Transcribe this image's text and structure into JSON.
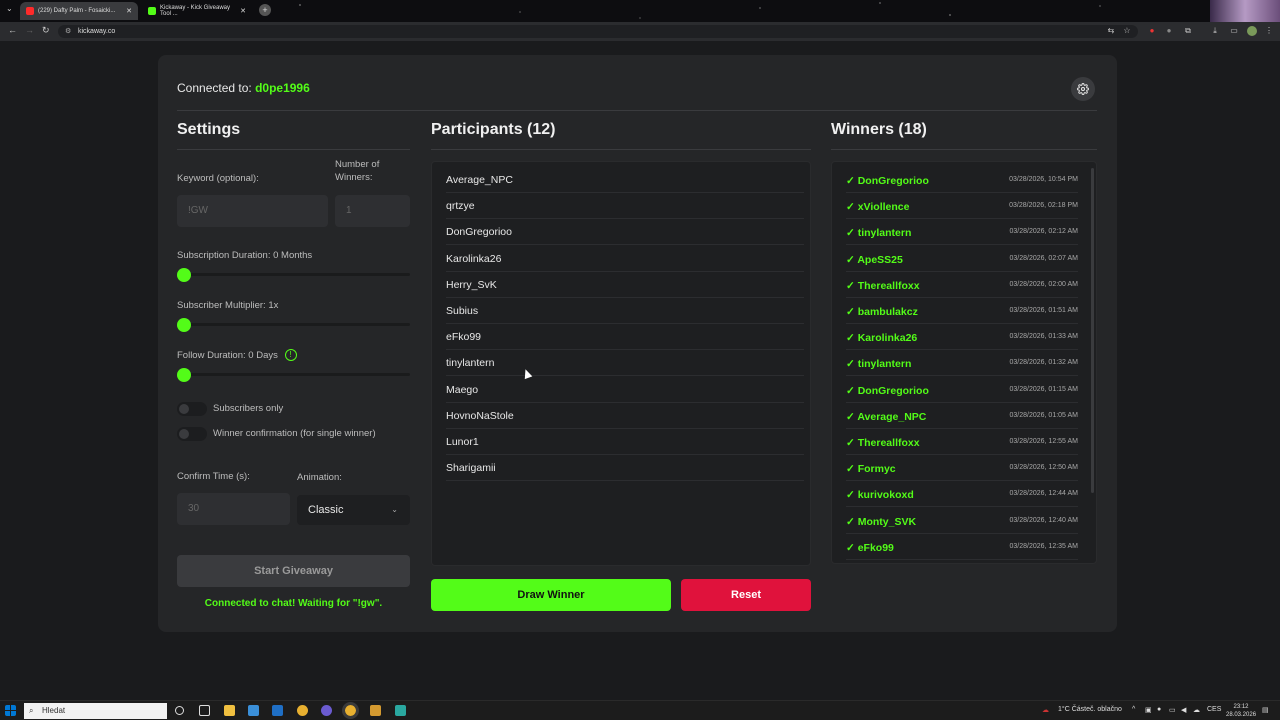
{
  "browser": {
    "tabs": [
      {
        "title": "(229) Dafty Palm - Fosaicki...",
        "active": true
      },
      {
        "title": "Kickaway - Kick Giveaway Tool ...",
        "active": false
      }
    ],
    "url": "kickaway.co"
  },
  "header": {
    "connected_prefix": "Connected to:",
    "username": "d0pe1996"
  },
  "settings": {
    "title": "Settings",
    "keyword_label": "Keyword (optional):",
    "keyword_placeholder": "!GW",
    "winners_label": "Number of Winners:",
    "winners_placeholder": "1",
    "sub_duration_label": "Subscription Duration: 0 Months",
    "sub_multiplier_label": "Subscriber Multiplier: 1x",
    "follow_label": "Follow Duration:",
    "follow_value": "0  Days",
    "follow_info": "!",
    "sliders": {
      "sub_duration": 0,
      "sub_multiplier": 0,
      "follow_duration": 0
    },
    "subscribers_only": "Subscribers only",
    "winner_confirmation": "Winner confirmation (for single winner)",
    "confirm_label": "Confirm Time (s):",
    "confirm_placeholder": "30",
    "animation_label": "Animation:",
    "animation_value": "Classic",
    "start_button": "Start Giveaway",
    "chat_status": "Connected to chat! Waiting for \"!gw\"."
  },
  "participants": {
    "title": "Participants (12)",
    "items": [
      "Average_NPC",
      "qrtzye",
      "DonGregorioo",
      "Karolinka26",
      "Herry_SvK",
      "Subius",
      "eFko99",
      "tinylantern",
      "Maego",
      "HovnoNaStole",
      "Lunor1",
      "Sharigamii"
    ]
  },
  "winners": {
    "title": "Winners (18)",
    "check": "✓",
    "items": [
      {
        "name": "DonGregorioo",
        "time": "03/28/2026, 10:54 PM"
      },
      {
        "name": "xViollence",
        "time": "03/28/2026, 02:18 PM"
      },
      {
        "name": "tinylantern",
        "time": "03/28/2026, 02:12 AM"
      },
      {
        "name": "ApeSS25",
        "time": "03/28/2026, 02:07 AM"
      },
      {
        "name": "Thereallfoxx",
        "time": "03/28/2026, 02:00 AM"
      },
      {
        "name": "bambulakcz",
        "time": "03/28/2026, 01:51 AM"
      },
      {
        "name": "Karolinka26",
        "time": "03/28/2026, 01:33 AM"
      },
      {
        "name": "tinylantern",
        "time": "03/28/2026, 01:32 AM"
      },
      {
        "name": "DonGregorioo",
        "time": "03/28/2026, 01:15 AM"
      },
      {
        "name": "Average_NPC",
        "time": "03/28/2026, 01:05 AM"
      },
      {
        "name": "Thereallfoxx",
        "time": "03/28/2026, 12:55 AM"
      },
      {
        "name": "Formyc",
        "time": "03/28/2026, 12:50 AM"
      },
      {
        "name": "kurivokoxd",
        "time": "03/28/2026, 12:44 AM"
      },
      {
        "name": "Monty_SVK",
        "time": "03/28/2026, 12:40 AM"
      },
      {
        "name": "eFko99",
        "time": "03/28/2026, 12:35 AM"
      }
    ]
  },
  "actions": {
    "draw": "Draw Winner",
    "reset": "Reset"
  },
  "taskbar": {
    "search": "Hledat",
    "weather": "1°C  Částeč. oblačno",
    "lang": "CES",
    "time": "23:12",
    "date": "28.03.2026"
  },
  "colors": {
    "accent": "#53fc18",
    "danger": "#e0123c",
    "card": "#252628"
  }
}
